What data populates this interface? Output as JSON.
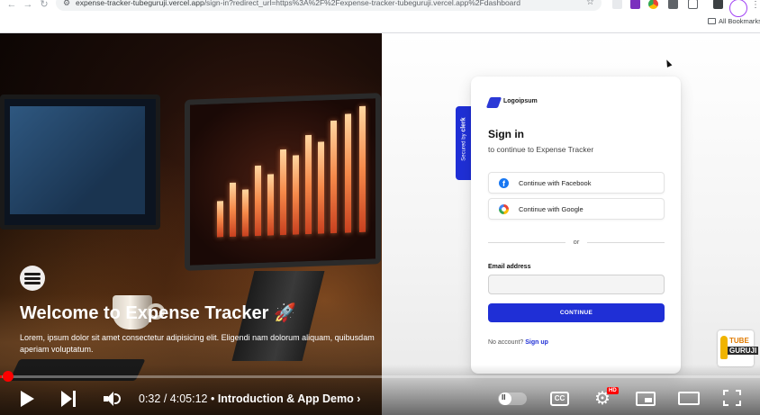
{
  "browser": {
    "url_host": "expense-tracker-tubeguruji.vercel.app",
    "url_path": "/sign-in?redirect_url=https%3A%2F%2Fexpense-tracker-tubeguruji.vercel.app%2Fdashboard",
    "bookmarks_label": "All Bookmarks"
  },
  "hero": {
    "title": "Welcome to Expense Tracker 🚀",
    "description": "Lorem, ipsum dolor sit amet consectetur adipisicing elit. Eligendi nam dolorum aliquam, quibusdam aperiam voluptatum."
  },
  "clerk": {
    "secured_by": "Secured by",
    "brand": "clerk"
  },
  "signin": {
    "logo_text": "Logoipsum",
    "title": "Sign in",
    "subtitle": "to continue to Expense Tracker",
    "facebook_label": "Continue with Facebook",
    "google_label": "Continue with Google",
    "divider_text": "or",
    "email_label": "Email address",
    "email_value": "",
    "continue_label": "CONTINUE",
    "no_account_text": "No account?",
    "signup_link": "Sign up"
  },
  "channel_logo": {
    "line1": "TUBE",
    "line2": "GURUJI"
  },
  "player": {
    "current_time": "0:32",
    "duration": "4:05:12",
    "time_separator": " / ",
    "chapter_separator": " • ",
    "chapter": "Introduction & App Demo",
    "chapter_chevron": "›",
    "cc_label": "CC",
    "quality_badge": "HD",
    "progress_fraction": 0.002
  },
  "colors": {
    "accent": "#1f2fd6",
    "youtube_red": "#ff0000"
  },
  "icons": {
    "back": "arrow-left-icon",
    "forward": "arrow-right-icon",
    "star": "star-icon",
    "facebook": "facebook-icon",
    "google": "google-icon",
    "settings": "gear-icon"
  }
}
